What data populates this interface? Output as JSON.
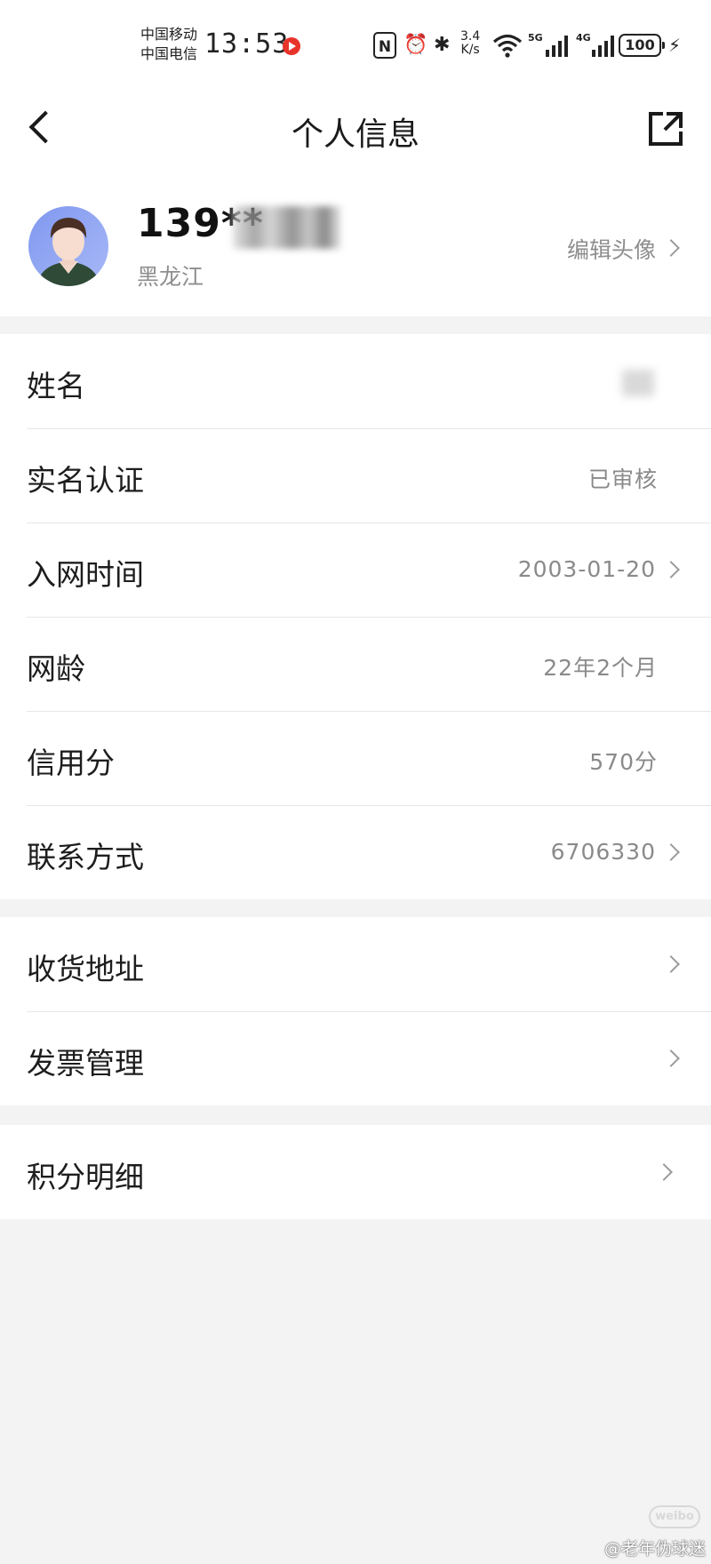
{
  "status_bar": {
    "carrier_1": "中国移动",
    "carrier_2": "中国电信",
    "time": "13:53",
    "net_speed": "3.4\nK/s",
    "signal_1": "5G",
    "signal_2": "4G",
    "battery": "100",
    "icons": [
      "recording-icon",
      "nfc-icon",
      "alarm-icon",
      "bluetooth-icon",
      "wifi-icon",
      "signal-icon",
      "battery-icon",
      "charging-icon"
    ]
  },
  "nav": {
    "title": "个人信息",
    "back_icon": "chevron-left-icon",
    "share_icon": "share-icon"
  },
  "profile": {
    "phone_masked": "139**",
    "province": "黑龙江",
    "edit_avatar_label": "编辑头像"
  },
  "info_rows": [
    {
      "label": "姓名",
      "value": "",
      "has_chevron": false
    },
    {
      "label": "实名认证",
      "value": "已审核",
      "has_chevron": false
    },
    {
      "label": "入网时间",
      "value": "2003-01-20",
      "has_chevron": true
    },
    {
      "label": "网龄",
      "value": "22年2个月",
      "has_chevron": false
    },
    {
      "label": "信用分",
      "value": "570分",
      "has_chevron": false
    },
    {
      "label": "联系方式",
      "value": "6706330",
      "has_chevron": true
    }
  ],
  "service_rows": [
    {
      "label": "收货地址",
      "has_chevron": true
    },
    {
      "label": "发票管理",
      "has_chevron": true
    }
  ],
  "points_row": {
    "label": "积分明细",
    "has_chevron": true
  },
  "watermark": {
    "text": "@老年伪球迷",
    "logo": "weibo"
  },
  "colors": {
    "background": "#f3f3f3",
    "card": "#ffffff",
    "muted_text": "#8a8a8a",
    "record_red": "#e8332a"
  }
}
